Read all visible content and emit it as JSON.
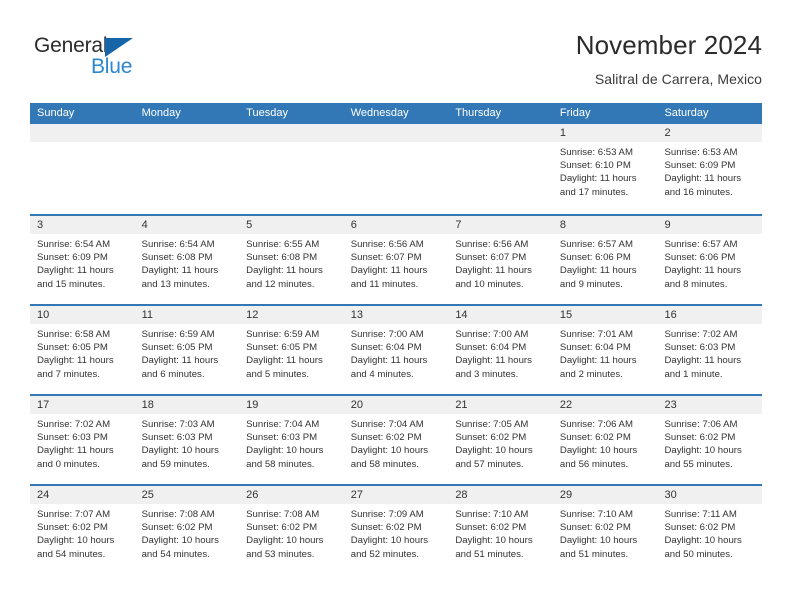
{
  "brand": {
    "name_part1": "General",
    "name_part2": "Blue",
    "accent_color": "#1565a8",
    "accent_color_light": "#2c86d0"
  },
  "header": {
    "title": "November 2024",
    "subtitle": "Salitral de Carrera, Mexico"
  },
  "theme": {
    "header_bg": "#3278b6",
    "day_band_bg": "#f0f0f0",
    "text_color": "#333333"
  },
  "calendar": {
    "day_names": [
      "Sunday",
      "Monday",
      "Tuesday",
      "Wednesday",
      "Thursday",
      "Friday",
      "Saturday"
    ],
    "weeks": [
      [
        {
          "day": "",
          "lines": []
        },
        {
          "day": "",
          "lines": []
        },
        {
          "day": "",
          "lines": []
        },
        {
          "day": "",
          "lines": []
        },
        {
          "day": "",
          "lines": []
        },
        {
          "day": "1",
          "lines": [
            "Sunrise: 6:53 AM",
            "Sunset: 6:10 PM",
            "Daylight: 11 hours",
            "and 17 minutes."
          ]
        },
        {
          "day": "2",
          "lines": [
            "Sunrise: 6:53 AM",
            "Sunset: 6:09 PM",
            "Daylight: 11 hours",
            "and 16 minutes."
          ]
        }
      ],
      [
        {
          "day": "3",
          "lines": [
            "Sunrise: 6:54 AM",
            "Sunset: 6:09 PM",
            "Daylight: 11 hours",
            "and 15 minutes."
          ]
        },
        {
          "day": "4",
          "lines": [
            "Sunrise: 6:54 AM",
            "Sunset: 6:08 PM",
            "Daylight: 11 hours",
            "and 13 minutes."
          ]
        },
        {
          "day": "5",
          "lines": [
            "Sunrise: 6:55 AM",
            "Sunset: 6:08 PM",
            "Daylight: 11 hours",
            "and 12 minutes."
          ]
        },
        {
          "day": "6",
          "lines": [
            "Sunrise: 6:56 AM",
            "Sunset: 6:07 PM",
            "Daylight: 11 hours",
            "and 11 minutes."
          ]
        },
        {
          "day": "7",
          "lines": [
            "Sunrise: 6:56 AM",
            "Sunset: 6:07 PM",
            "Daylight: 11 hours",
            "and 10 minutes."
          ]
        },
        {
          "day": "8",
          "lines": [
            "Sunrise: 6:57 AM",
            "Sunset: 6:06 PM",
            "Daylight: 11 hours",
            "and 9 minutes."
          ]
        },
        {
          "day": "9",
          "lines": [
            "Sunrise: 6:57 AM",
            "Sunset: 6:06 PM",
            "Daylight: 11 hours",
            "and 8 minutes."
          ]
        }
      ],
      [
        {
          "day": "10",
          "lines": [
            "Sunrise: 6:58 AM",
            "Sunset: 6:05 PM",
            "Daylight: 11 hours",
            "and 7 minutes."
          ]
        },
        {
          "day": "11",
          "lines": [
            "Sunrise: 6:59 AM",
            "Sunset: 6:05 PM",
            "Daylight: 11 hours",
            "and 6 minutes."
          ]
        },
        {
          "day": "12",
          "lines": [
            "Sunrise: 6:59 AM",
            "Sunset: 6:05 PM",
            "Daylight: 11 hours",
            "and 5 minutes."
          ]
        },
        {
          "day": "13",
          "lines": [
            "Sunrise: 7:00 AM",
            "Sunset: 6:04 PM",
            "Daylight: 11 hours",
            "and 4 minutes."
          ]
        },
        {
          "day": "14",
          "lines": [
            "Sunrise: 7:00 AM",
            "Sunset: 6:04 PM",
            "Daylight: 11 hours",
            "and 3 minutes."
          ]
        },
        {
          "day": "15",
          "lines": [
            "Sunrise: 7:01 AM",
            "Sunset: 6:04 PM",
            "Daylight: 11 hours",
            "and 2 minutes."
          ]
        },
        {
          "day": "16",
          "lines": [
            "Sunrise: 7:02 AM",
            "Sunset: 6:03 PM",
            "Daylight: 11 hours",
            "and 1 minute."
          ]
        }
      ],
      [
        {
          "day": "17",
          "lines": [
            "Sunrise: 7:02 AM",
            "Sunset: 6:03 PM",
            "Daylight: 11 hours",
            "and 0 minutes."
          ]
        },
        {
          "day": "18",
          "lines": [
            "Sunrise: 7:03 AM",
            "Sunset: 6:03 PM",
            "Daylight: 10 hours",
            "and 59 minutes."
          ]
        },
        {
          "day": "19",
          "lines": [
            "Sunrise: 7:04 AM",
            "Sunset: 6:03 PM",
            "Daylight: 10 hours",
            "and 58 minutes."
          ]
        },
        {
          "day": "20",
          "lines": [
            "Sunrise: 7:04 AM",
            "Sunset: 6:02 PM",
            "Daylight: 10 hours",
            "and 58 minutes."
          ]
        },
        {
          "day": "21",
          "lines": [
            "Sunrise: 7:05 AM",
            "Sunset: 6:02 PM",
            "Daylight: 10 hours",
            "and 57 minutes."
          ]
        },
        {
          "day": "22",
          "lines": [
            "Sunrise: 7:06 AM",
            "Sunset: 6:02 PM",
            "Daylight: 10 hours",
            "and 56 minutes."
          ]
        },
        {
          "day": "23",
          "lines": [
            "Sunrise: 7:06 AM",
            "Sunset: 6:02 PM",
            "Daylight: 10 hours",
            "and 55 minutes."
          ]
        }
      ],
      [
        {
          "day": "24",
          "lines": [
            "Sunrise: 7:07 AM",
            "Sunset: 6:02 PM",
            "Daylight: 10 hours",
            "and 54 minutes."
          ]
        },
        {
          "day": "25",
          "lines": [
            "Sunrise: 7:08 AM",
            "Sunset: 6:02 PM",
            "Daylight: 10 hours",
            "and 54 minutes."
          ]
        },
        {
          "day": "26",
          "lines": [
            "Sunrise: 7:08 AM",
            "Sunset: 6:02 PM",
            "Daylight: 10 hours",
            "and 53 minutes."
          ]
        },
        {
          "day": "27",
          "lines": [
            "Sunrise: 7:09 AM",
            "Sunset: 6:02 PM",
            "Daylight: 10 hours",
            "and 52 minutes."
          ]
        },
        {
          "day": "28",
          "lines": [
            "Sunrise: 7:10 AM",
            "Sunset: 6:02 PM",
            "Daylight: 10 hours",
            "and 51 minutes."
          ]
        },
        {
          "day": "29",
          "lines": [
            "Sunrise: 7:10 AM",
            "Sunset: 6:02 PM",
            "Daylight: 10 hours",
            "and 51 minutes."
          ]
        },
        {
          "day": "30",
          "lines": [
            "Sunrise: 7:11 AM",
            "Sunset: 6:02 PM",
            "Daylight: 10 hours",
            "and 50 minutes."
          ]
        }
      ]
    ]
  }
}
